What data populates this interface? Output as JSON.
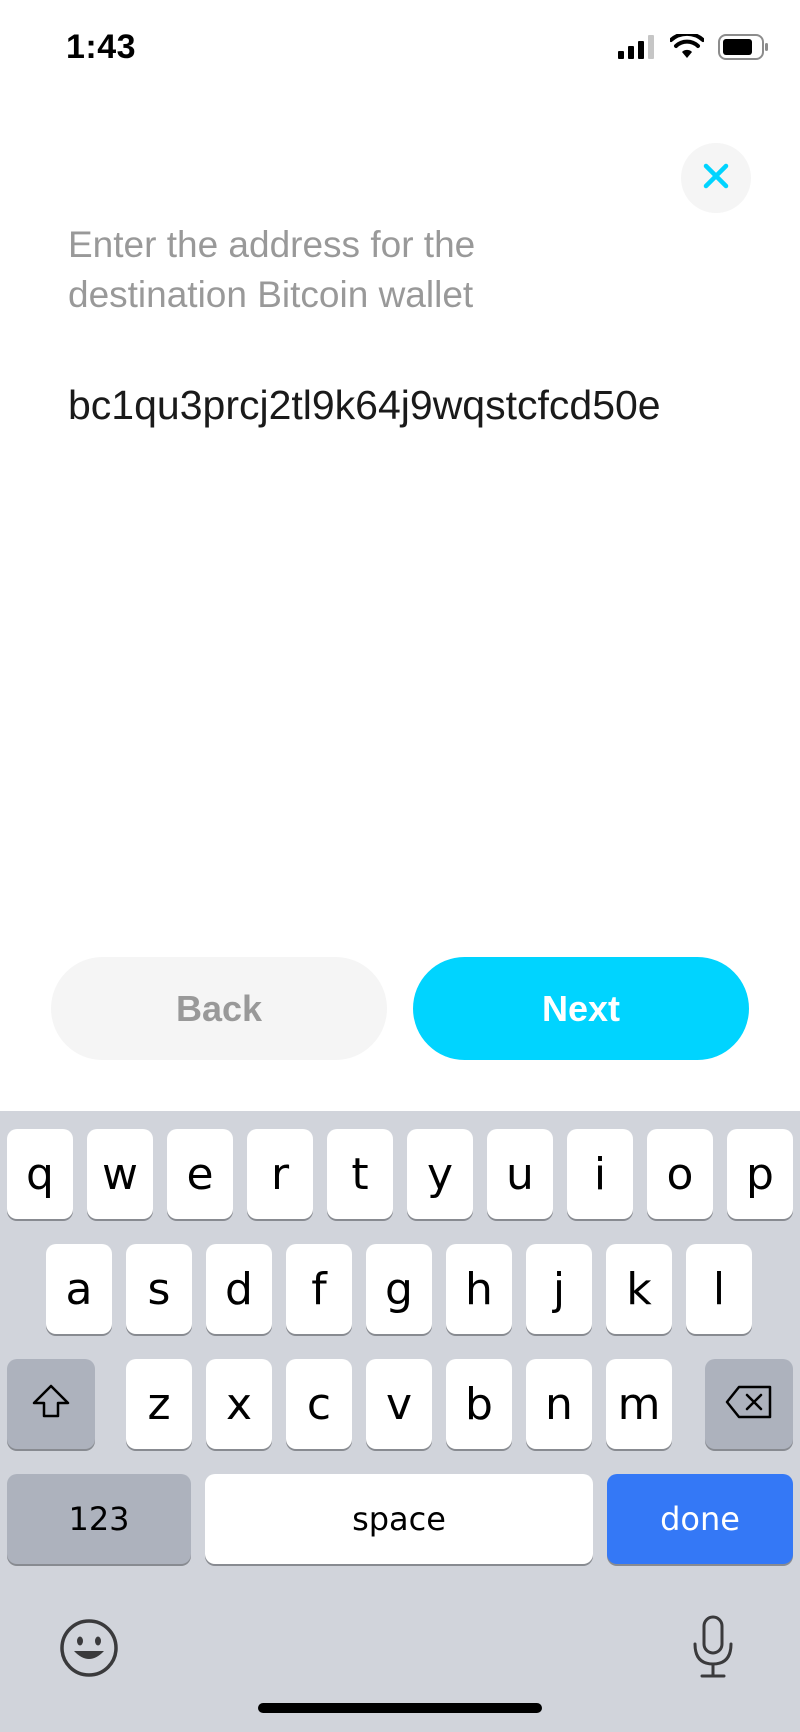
{
  "status_bar": {
    "time": "1:43"
  },
  "prompt": "Enter the address for the destination Bitcoin wallet",
  "address_input": {
    "value": "bc1qu3prcj2tl9k64j9wqstcfcd50e"
  },
  "buttons": {
    "back_label": "Back",
    "next_label": "Next"
  },
  "colors": {
    "accent": "#00d4ff",
    "keyboard_bg": "#d1d4db",
    "done_key": "#3478f6"
  },
  "keyboard": {
    "row1": [
      "q",
      "w",
      "e",
      "r",
      "t",
      "y",
      "u",
      "i",
      "o",
      "p"
    ],
    "row2": [
      "a",
      "s",
      "d",
      "f",
      "g",
      "h",
      "j",
      "k",
      "l"
    ],
    "row3": [
      "z",
      "x",
      "c",
      "v",
      "b",
      "n",
      "m"
    ],
    "numbers_label": "123",
    "space_label": "space",
    "done_label": "done",
    "icons": [
      "shift-icon",
      "backspace-icon",
      "emoji-icon",
      "microphone-icon"
    ]
  }
}
